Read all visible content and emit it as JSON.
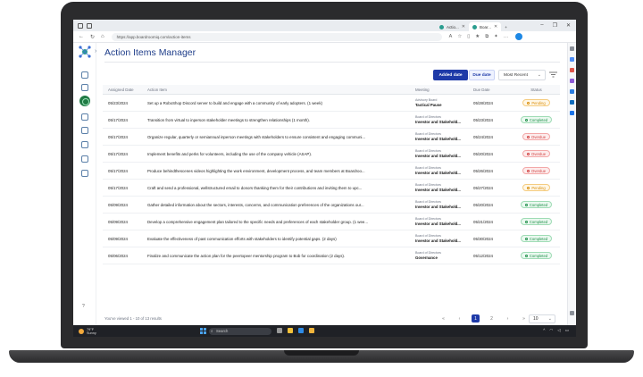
{
  "browser": {
    "tabs": [
      {
        "label": "Actio..."
      },
      {
        "label": "Boar..."
      }
    ],
    "url": "https://app.boardroomiq.com/action-items"
  },
  "app": {
    "title": "Action Items Manager",
    "sort_buttons": {
      "added": "Added date",
      "due": "Due date"
    },
    "sort_select": "Most Recent",
    "columns": [
      "Assigned Date",
      "Action Item",
      "Meeting",
      "Due Date",
      "Status"
    ],
    "rows": [
      {
        "assigned": "05/23/2024",
        "item": "Set up a RoboShop Discord server to build and engage with a community of early adopters. (1 week)",
        "meeting_top": "Advisory Board",
        "meeting": "Tactical Pause",
        "due": "05/28/2024",
        "status": "Pending"
      },
      {
        "assigned": "05/17/2024",
        "item": "Transition from virtual to inperson stakeholder meetings to strengthen relationships (1 month).",
        "meeting_top": "Board of Directors",
        "meeting": "Investor and Stakehold...",
        "due": "05/23/2024",
        "status": "Completed"
      },
      {
        "assigned": "05/17/2024",
        "item": "Organize regular, quarterly or semiannual inperson meetings with stakeholders to ensure consistent and engaging communi...",
        "meeting_top": "Board of Directors",
        "meeting": "Investor and Stakehold...",
        "due": "05/24/2024",
        "status": "Overdue"
      },
      {
        "assigned": "05/17/2024",
        "item": "Implement benefits and perks for volunteers, including the use of the company vehicle (ASAP).",
        "meeting_top": "Board of Directors",
        "meeting": "Investor and Stakehold...",
        "due": "05/20/2024",
        "status": "Overdue"
      },
      {
        "assigned": "05/17/2024",
        "item": "Produce behindthescenes videos highlighting the work environment, development process, and team members at Boardroo...",
        "meeting_top": "Board of Directors",
        "meeting": "Investor and Stakehold...",
        "due": "05/26/2024",
        "status": "Overdue"
      },
      {
        "assigned": "05/17/2024",
        "item": "Craft and send a professional, wellstructured email to donors thanking them for their contributions and inviting them to upc...",
        "meeting_top": "Board of Directors",
        "meeting": "Investor and Stakehold...",
        "due": "05/27/2024",
        "status": "Pending"
      },
      {
        "assigned": "05/09/2024",
        "item": "Gather detailed information about the sectors, interests, concerns, and communication preferences of the organizations our...",
        "meeting_top": "Board of Directors",
        "meeting": "Investor and Stakehold...",
        "due": "05/20/2024",
        "status": "Completed"
      },
      {
        "assigned": "05/09/2024",
        "item": "Develop a comprehensive engagement plan tailored to the specific needs and preferences of each stakeholder group. (1 wee...",
        "meeting_top": "Board of Directors",
        "meeting": "Investor and Stakehold...",
        "due": "05/21/2024",
        "status": "Completed"
      },
      {
        "assigned": "05/09/2024",
        "item": "Evaluate the effectiveness of past communication efforts with stakeholders to identify potential gaps. (2 days)",
        "meeting_top": "Board of Directors",
        "meeting": "Investor and Stakehold...",
        "due": "05/30/2024",
        "status": "Completed"
      },
      {
        "assigned": "05/06/2024",
        "item": "Finalize and communicate the action plan for the peertopeer mentorship program to Bob for coordination (2 days).",
        "meeting_top": "Board of Directors",
        "meeting": "Governance",
        "due": "05/12/2024",
        "status": "Completed"
      }
    ],
    "footer_text": "You've viewed 1 - 10 of 13 results",
    "pagination": {
      "pages": [
        "1",
        "2"
      ],
      "page_size": "10"
    }
  },
  "taskbar": {
    "weather_temp": "79°F",
    "weather_desc": "Sunny",
    "search_placeholder": "Search"
  },
  "colors": {
    "title": "#1f3e8a",
    "primary": "#1e3aa8",
    "pending": "#d98e0c",
    "completed": "#1f8f4a",
    "overdue": "#d14343"
  }
}
